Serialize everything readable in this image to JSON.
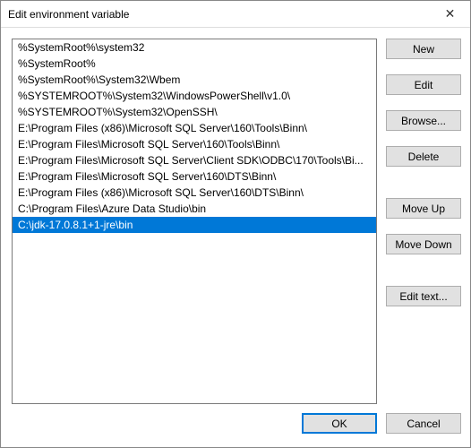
{
  "window": {
    "title": "Edit environment variable"
  },
  "list": {
    "selected_index": 11,
    "items": [
      "%SystemRoot%\\system32",
      "%SystemRoot%",
      "%SystemRoot%\\System32\\Wbem",
      "%SYSTEMROOT%\\System32\\WindowsPowerShell\\v1.0\\",
      "%SYSTEMROOT%\\System32\\OpenSSH\\",
      "E:\\Program Files (x86)\\Microsoft SQL Server\\160\\Tools\\Binn\\",
      "E:\\Program Files\\Microsoft SQL Server\\160\\Tools\\Binn\\",
      "E:\\Program Files\\Microsoft SQL Server\\Client SDK\\ODBC\\170\\Tools\\Bi...",
      "E:\\Program Files\\Microsoft SQL Server\\160\\DTS\\Binn\\",
      "E:\\Program Files (x86)\\Microsoft SQL Server\\160\\DTS\\Binn\\",
      "C:\\Program Files\\Azure Data Studio\\bin",
      "C:\\jdk-17.0.8.1+1-jre\\bin"
    ]
  },
  "buttons": {
    "new": "New",
    "edit": "Edit",
    "browse": "Browse...",
    "delete": "Delete",
    "move_up": "Move Up",
    "move_down": "Move Down",
    "edit_text": "Edit text...",
    "ok": "OK",
    "cancel": "Cancel"
  }
}
